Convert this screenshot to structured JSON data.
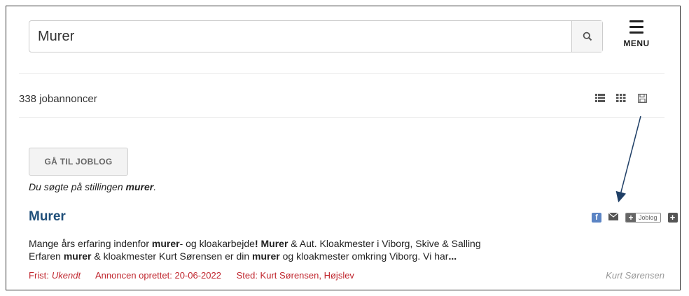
{
  "search": {
    "value": "Murer",
    "icon": "search-icon"
  },
  "menu": {
    "label": "MENU"
  },
  "results": {
    "count_text": "338 jobannoncer"
  },
  "joblog_button": {
    "label": "GÅ TIL JOBLOG"
  },
  "search_note": {
    "prefix": "Du søgte på stillingen ",
    "term": "murer",
    "suffix": "."
  },
  "job": {
    "title": "Murer",
    "actions": {
      "facebook_label": "f",
      "joblog_tag": "Joblog"
    },
    "description": {
      "l1_a": "Mange års erfaring indenfor ",
      "l1_b": "murer",
      "l1_c": "- og kloakarbejde",
      "l1_d": "! Murer",
      "l1_e": " & Aut. Kloakmester i Viborg, Skive & Salling",
      "l2_a": "Erfaren ",
      "l2_b": "murer",
      "l2_c": " & kloakmester Kurt Sørensen er din ",
      "l2_d": "murer",
      "l2_e": " og kloakmester omkring Viborg. Vi har",
      "l2_f": "..."
    },
    "deadline_label": "Frist:",
    "deadline_value": "Ukendt",
    "created": "Annoncen oprettet: 20-06-2022",
    "location": "Sted: Kurt Sørensen, Højslev",
    "company": "Kurt Sørensen"
  }
}
